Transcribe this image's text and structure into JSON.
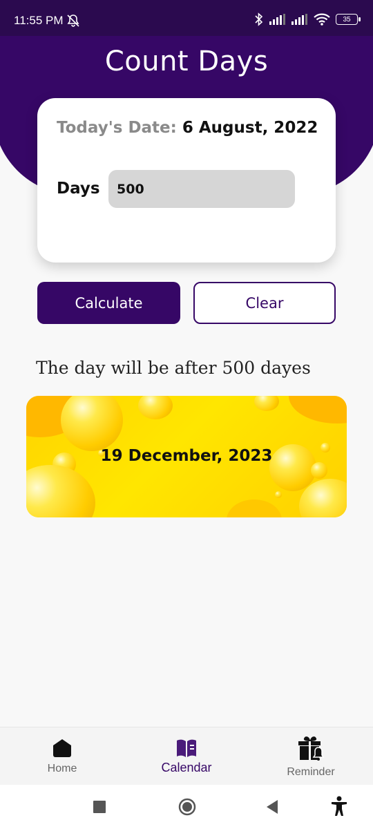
{
  "status": {
    "time": "11:55 PM",
    "battery": "35"
  },
  "header": {
    "title": "Count Days"
  },
  "card": {
    "date_label": "Today's Date: ",
    "date_value": "6 August, 2022",
    "days_label": "Days",
    "days_value": "500"
  },
  "buttons": {
    "calculate": "Calculate",
    "clear": "Clear"
  },
  "result": {
    "text": "The day will be after 500 dayes",
    "date": "19 December, 2023"
  },
  "nav": {
    "items": [
      {
        "label": "Home",
        "icon": "home-icon"
      },
      {
        "label": "Calendar",
        "icon": "book-icon"
      },
      {
        "label": "Reminder",
        "icon": "gift-icon"
      }
    ],
    "active": "Calendar"
  },
  "colors": {
    "primary": "#360766",
    "accent": "#ffd400"
  }
}
